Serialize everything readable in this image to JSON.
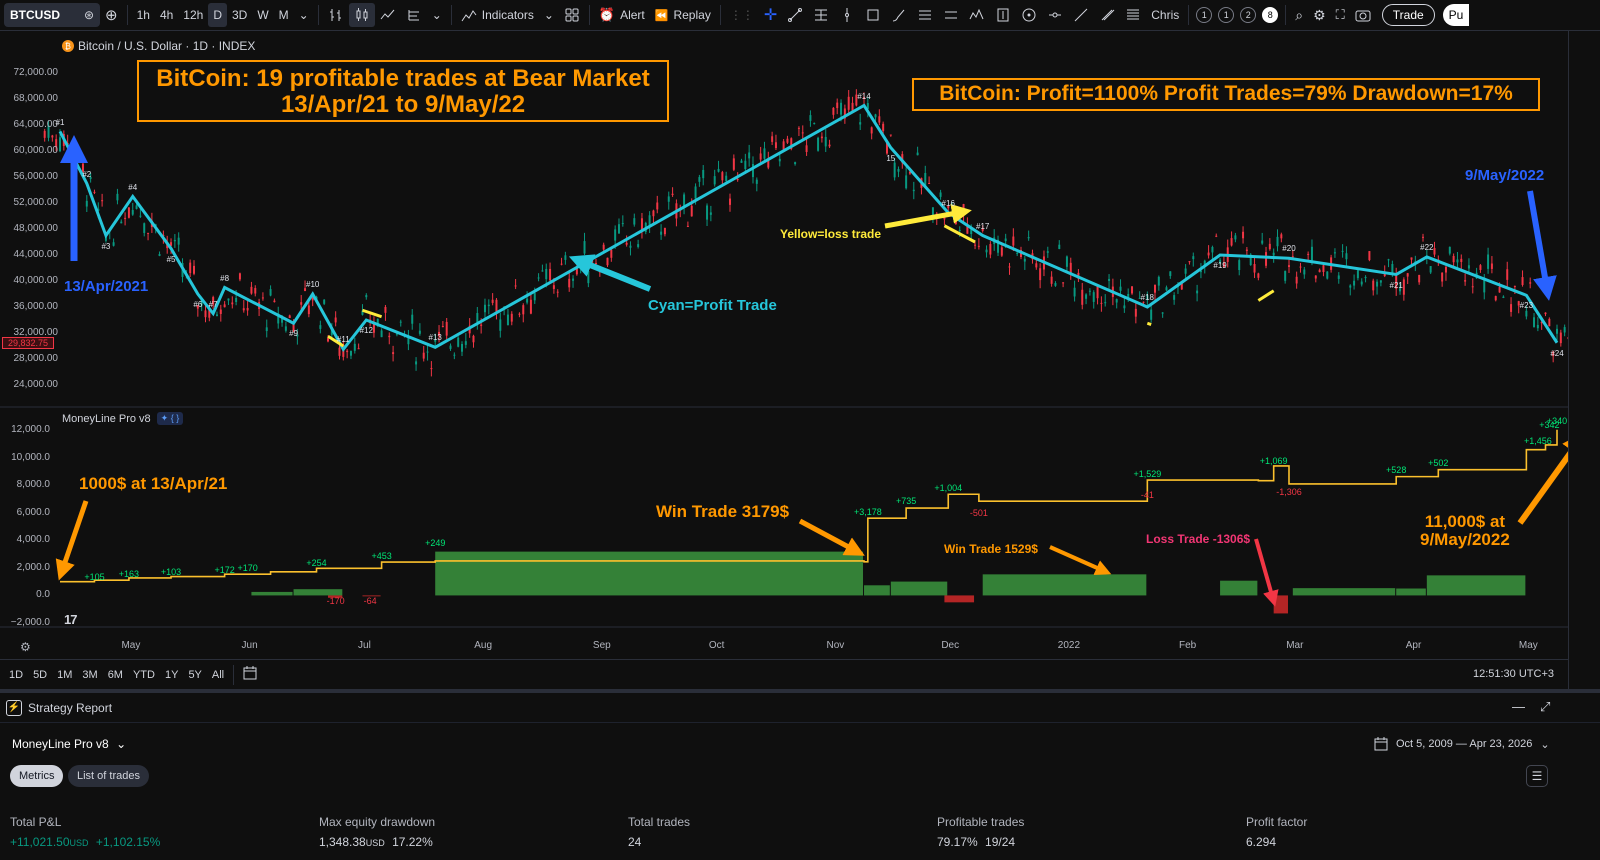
{
  "toolbar": {
    "symbol": "BTCUSD",
    "intervals": [
      "1h",
      "4h",
      "12h",
      "D",
      "3D",
      "W",
      "M"
    ],
    "active_interval": "D",
    "indicators_label": "Indicators",
    "alert_label": "Alert",
    "replay_label": "Replay",
    "user_label": "Chris",
    "layouts": [
      "1",
      "1",
      "2",
      "8"
    ],
    "trade_label": "Trade",
    "publish_label": "Pu"
  },
  "chart": {
    "title": "Bitcoin / U.S. Dollar · 1D · INDEX",
    "last_price": "29,832.75",
    "price_axis": [
      "72,000.00",
      "68,000.00",
      "64,000.00",
      "60,000.00",
      "56,000.00",
      "52,000.00",
      "48,000.00",
      "44,000.00",
      "40,000.00",
      "36,000.00",
      "32,000.00",
      "28,000.00",
      "24,000.00"
    ],
    "equity_axis": [
      "12,000.0",
      "10,000.0",
      "8,000.0",
      "6,000.0",
      "4,000.0",
      "2,000.0",
      "0.0",
      "−2,000.0"
    ],
    "time_axis": [
      "May",
      "Jun",
      "Jul",
      "Aug",
      "Sep",
      "Oct",
      "Nov",
      "Dec",
      "2022",
      "Feb",
      "Mar",
      "Apr",
      "May"
    ],
    "indicator_title": "MoneyLine Pro v8",
    "annotations": {
      "title_box_line1": "BitCoin: 19 profitable trades at Bear Market",
      "title_box_line2": "13/Apr/21    to    9/May/22",
      "stats_box": "BitCoin: Profit=1100%   Profit Trades=79%   Drawdown=17%",
      "start_date": "13/Apr/2021",
      "end_date": "9/May/2022",
      "cyan_note": "Cyan=Profit Trade",
      "yellow_note": "Yellow=loss trade",
      "start_equity": "1000$ at 13/Apr/21",
      "win_3179": "Win Trade 3179$",
      "win_1529": "Win Trade 1529$",
      "loss_1306": "Loss Trade -1306$",
      "end_equity_line1": "11,000$ at",
      "end_equity_line2": "9/May/2022"
    },
    "trade_labels": [
      "#1",
      "#2",
      "#3",
      "#4",
      "#5",
      "#6",
      "#7",
      "#8",
      "#9",
      "#10",
      "#11",
      "#12",
      "#13",
      "#14",
      "15",
      "#16",
      "#17",
      "#18",
      "#19",
      "#20",
      "#21",
      "#22",
      "#23",
      "#24"
    ],
    "pnl_labels": [
      "+105",
      "+163",
      "+103",
      "+172",
      "+170",
      "+254",
      "+453",
      "-170",
      "-64",
      "+249",
      "+3,178",
      "+735",
      "+1,004",
      "-501",
      "+1,529",
      "-41",
      "+1,069",
      "-1,306",
      "+528",
      "+502",
      "+1,456",
      "+342",
      "+340"
    ]
  },
  "chart_data": {
    "type": "line",
    "title": "Bitcoin / U.S. Dollar · 1D · INDEX",
    "xlabel": "",
    "ylabel": "",
    "x_range": [
      "2021-04-13",
      "2022-05-09"
    ],
    "ylim": [
      24000,
      72000
    ],
    "series": [
      {
        "name": "Cyan=Profit Trade",
        "points": [
          [
            "2021-04-13",
            63000
          ],
          [
            "2021-04-20",
            55000
          ],
          [
            "2021-04-25",
            47000
          ],
          [
            "2021-05-02",
            53000
          ],
          [
            "2021-05-12",
            45000
          ],
          [
            "2021-05-19",
            38000
          ],
          [
            "2021-05-23",
            35000
          ],
          [
            "2021-05-26",
            39000
          ],
          [
            "2021-06-13",
            33500
          ],
          [
            "2021-06-18",
            38000
          ],
          [
            "2021-06-26",
            29500
          ],
          [
            "2021-07-02",
            34000
          ],
          [
            "2021-07-20",
            29800
          ],
          [
            "2021-11-09",
            67000
          ],
          [
            "2021-11-16",
            60500
          ],
          [
            "2021-12-01",
            50500
          ],
          [
            "2021-12-10",
            47000
          ],
          [
            "2022-01-22",
            36000
          ],
          [
            "2022-02-10",
            44000
          ],
          [
            "2022-02-28",
            43500
          ],
          [
            "2022-03-28",
            41000
          ],
          [
            "2022-04-05",
            43700
          ],
          [
            "2022-05-01",
            37800
          ],
          [
            "2022-05-09",
            30500
          ]
        ]
      },
      {
        "name": "Yellow=loss trade",
        "segments": [
          [
            [
              "2021-06-22",
              31500
            ],
            [
              "2021-06-26",
              30000
            ]
          ],
          [
            [
              "2021-07-01",
              35500
            ],
            [
              "2021-07-06",
              34500
            ]
          ],
          [
            [
              "2021-11-30",
              48500
            ],
            [
              "2021-12-08",
              46000
            ]
          ],
          [
            [
              "2022-01-22",
              33500
            ],
            [
              "2022-01-23",
              33300
            ]
          ],
          [
            [
              "2022-02-20",
              37000
            ],
            [
              "2022-02-24",
              38500
            ]
          ]
        ]
      }
    ],
    "equity_panel": {
      "type": "area",
      "ylim": [
        -2000,
        12000
      ],
      "equity": [
        [
          "2021-04-13",
          1000
        ],
        [
          "2021-04-22",
          1105
        ],
        [
          "2021-05-01",
          1268
        ],
        [
          "2021-05-12",
          1371
        ],
        [
          "2021-05-26",
          1543
        ],
        [
          "2021-06-07",
          1713
        ],
        [
          "2021-06-19",
          1967
        ],
        [
          "2021-07-06",
          2420
        ],
        [
          "2021-07-20",
          2499
        ],
        [
          "2021-11-09",
          2435
        ],
        [
          "2021-11-10",
          5600
        ],
        [
          "2021-11-20",
          6335
        ],
        [
          "2021-12-01",
          7339
        ],
        [
          "2021-12-09",
          6838
        ],
        [
          "2022-01-22",
          8367
        ],
        [
          "2022-02-20",
          8326
        ],
        [
          "2022-02-24",
          9395
        ],
        [
          "2022-02-28",
          8089
        ],
        [
          "2022-03-28",
          8617
        ],
        [
          "2022-04-08",
          9119
        ],
        [
          "2022-05-01",
          10575
        ],
        [
          "2022-05-06",
          10917
        ],
        [
          "2022-05-09",
          12021
        ]
      ],
      "trade_pnl": [
        {
          "start": "2021-07-20",
          "end": "2021-11-09",
          "value": 3178
        },
        {
          "start": "2021-12-10",
          "end": "2022-01-22",
          "value": 1529
        },
        {
          "start": "2022-04-05",
          "end": "2022-05-01",
          "value": 1456
        },
        {
          "start": "2021-11-16",
          "end": "2021-12-01",
          "value": 1004
        },
        {
          "start": "2021-11-09",
          "end": "2021-11-16",
          "value": 735
        },
        {
          "start": "2022-03-01",
          "end": "2022-03-28",
          "value": 528
        },
        {
          "start": "2022-03-28",
          "end": "2022-04-05",
          "value": 502
        },
        {
          "start": "2021-06-13",
          "end": "2021-06-26",
          "value": 453
        },
        {
          "start": "2021-06-02",
          "end": "2021-06-13",
          "value": 254
        },
        {
          "start": "2022-02-10",
          "end": "2022-02-20",
          "value": 1069
        },
        {
          "start": "2021-11-30",
          "end": "2021-12-08",
          "value": -501
        },
        {
          "start": "2022-02-24",
          "end": "2022-02-28",
          "value": -1306
        },
        {
          "start": "2021-06-22",
          "end": "2021-06-26",
          "value": -170
        },
        {
          "start": "2021-07-01",
          "end": "2021-07-06",
          "value": -64
        }
      ]
    }
  },
  "range_bar": {
    "ranges": [
      "1D",
      "5D",
      "1M",
      "3M",
      "6M",
      "YTD",
      "1Y",
      "5Y",
      "All"
    ],
    "clock": "12:51:30 UTC+3"
  },
  "report": {
    "panel_title": "Strategy Report",
    "strategy_name": "MoneyLine Pro v8",
    "date_range": "Oct 5, 2009 — Apr 23, 2026",
    "tabs": [
      "Metrics",
      "List of trades"
    ],
    "metrics": [
      {
        "label": "Total P&L",
        "value": "+11,021.50",
        "unit": "USD",
        "extra": "+1,102.15%"
      },
      {
        "label": "Max equity drawdown",
        "value": "1,348.38",
        "unit": "USD",
        "extra": "17.22%"
      },
      {
        "label": "Total trades",
        "value": "24",
        "unit": "",
        "extra": ""
      },
      {
        "label": "Profitable trades",
        "value": "79.17%",
        "unit": "",
        "extra": "19/24"
      },
      {
        "label": "Profit factor",
        "value": "6.294",
        "unit": "",
        "extra": ""
      }
    ]
  }
}
